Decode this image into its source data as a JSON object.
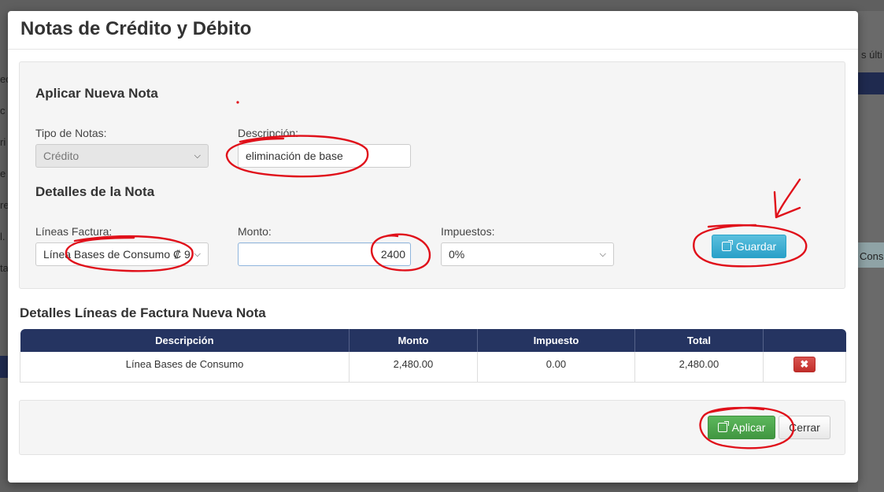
{
  "modal": {
    "title": "Notas de Crédito y Débito"
  },
  "new_note": {
    "heading": "Aplicar Nueva Nota",
    "tipo_label": "Tipo de Notas:",
    "tipo_value": "Crédito",
    "descripcion_label": "Descripción:",
    "descripcion_value": "eliminación de base"
  },
  "details": {
    "heading": "Detalles de la Nota",
    "lineas_label": "Líneas Factura:",
    "lineas_value": "Línea Bases de Consumo ₡ 9",
    "monto_label": "Monto:",
    "monto_value": "2400",
    "impuestos_label": "Impuestos:",
    "impuestos_value": "0%",
    "guardar_label": "Guardar"
  },
  "lines_table": {
    "title": "Detalles Líneas de Factura Nueva Nota",
    "columns": [
      "Descripción",
      "Monto",
      "Impuesto",
      "Total",
      ""
    ],
    "rows": [
      {
        "descripcion": "Línea Bases de Consumo",
        "monto": "2,480.00",
        "impuesto": "0.00",
        "total": "2,480.00"
      }
    ]
  },
  "footer": {
    "aplicar_label": "Aplicar",
    "cerrar_label": "Cerrar"
  },
  "background": {
    "frag_right_top": "s últi",
    "frag_right_mid": "Cons",
    "frag_left": [
      "ed",
      "c",
      "ri",
      "e",
      "re",
      "l.",
      "ta"
    ]
  },
  "colors": {
    "table_header": "#253461",
    "info": "#31b0d5",
    "success": "#449d44",
    "danger": "#c9302c",
    "annotation": "#e0101a"
  }
}
